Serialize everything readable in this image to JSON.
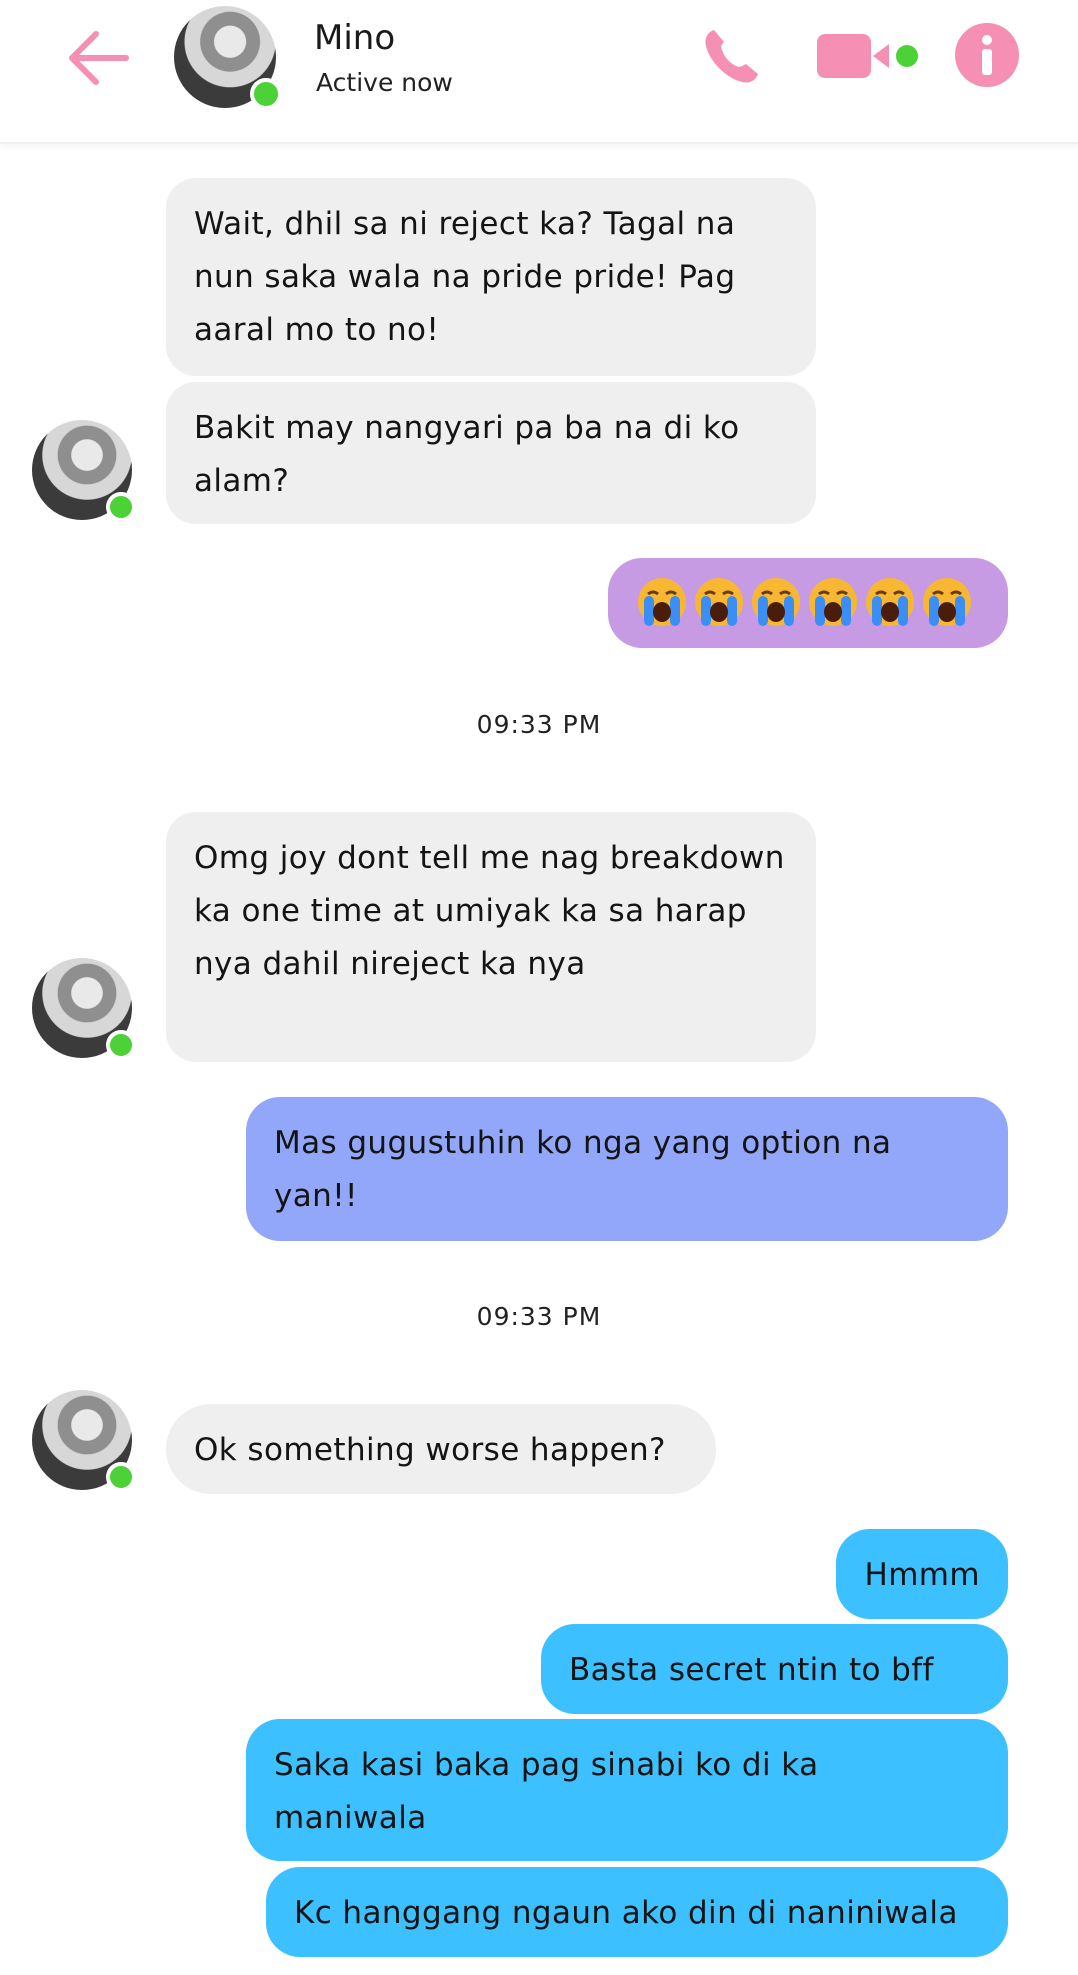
{
  "header": {
    "contact_name": "Mino",
    "status": "Active now",
    "icons": [
      "back-arrow-icon",
      "phone-icon",
      "video-camera-icon",
      "info-icon"
    ],
    "accent_color": "#f58fb4",
    "online_color": "#4cd137"
  },
  "messages": [
    {
      "from": "them",
      "text": "Wait, dhil sa ni reject ka? Tagal na nun saka wala na pride pride! Pag aaral mo to no!"
    },
    {
      "from": "them",
      "text": "Bakit may nangyari pa ba na di ko alam?"
    },
    {
      "from": "me",
      "emoji": "loudly-crying-face",
      "count": 6
    },
    {
      "timestamp": "09:33 PM"
    },
    {
      "from": "them",
      "text": "Omg joy dont tell me nag breakdown ka one time at umiyak ka sa harap nya dahil nireject ka nya"
    },
    {
      "from": "me",
      "text": "Mas gugustuhin ko nga yang option na yan!!"
    },
    {
      "timestamp": "09:33 PM"
    },
    {
      "from": "them",
      "text": "Ok something worse happen?"
    },
    {
      "from": "me",
      "text": "Hmmm"
    },
    {
      "from": "me",
      "text": "Basta secret ntin to bff"
    },
    {
      "from": "me",
      "text": "Saka kasi baka pag sinabi ko di ka maniwala"
    },
    {
      "from": "me",
      "text": "Kc hanggang ngaun ako din di naniniwala"
    }
  ],
  "colors": {
    "incoming_bubble": "#efefef",
    "emoji_bubble": "#c79be4",
    "violet_bubble": "#92a7fa",
    "blue_bubble": "#3dc0ff"
  }
}
